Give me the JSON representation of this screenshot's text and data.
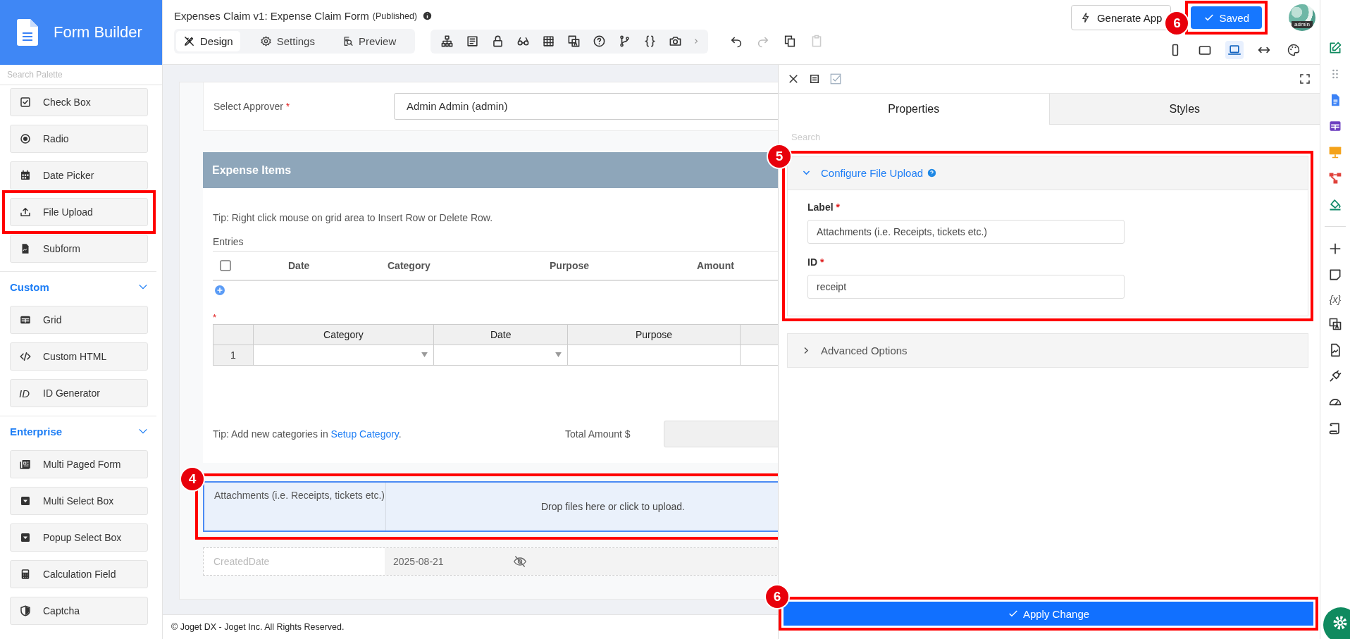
{
  "app": {
    "title": "Form Builder"
  },
  "palette": {
    "search_placeholder": "Search Palette",
    "groups": [
      {
        "items": [
          {
            "label": "Check Box",
            "kind": "checkbox",
            "marked": false
          },
          {
            "label": "Radio",
            "kind": "radio",
            "marked": false
          },
          {
            "label": "Date Picker",
            "kind": "calendar",
            "marked": false
          },
          {
            "label": "File Upload",
            "kind": "upload",
            "marked": true
          },
          {
            "label": "Subform",
            "kind": "document",
            "marked": false
          }
        ]
      },
      {
        "title": "Custom",
        "expanded": true,
        "items": [
          {
            "label": "Grid",
            "kind": "grid",
            "marked": false
          },
          {
            "label": "Custom HTML",
            "kind": "code",
            "marked": false
          },
          {
            "label": "ID Generator",
            "kind": "glyph",
            "glyph": "ID",
            "marked": false
          }
        ]
      },
      {
        "title": "Enterprise",
        "expanded": true,
        "items": [
          {
            "label": "Multi Paged Form",
            "kind": "pages",
            "marked": false
          },
          {
            "label": "Multi Select Box",
            "kind": "dropdown",
            "marked": false
          },
          {
            "label": "Popup Select Box",
            "kind": "dropdown",
            "marked": false
          },
          {
            "label": "Calculation Field",
            "kind": "calculator",
            "marked": false
          },
          {
            "label": "Captcha",
            "kind": "shield",
            "marked": false
          }
        ]
      }
    ]
  },
  "header": {
    "title": "Expenses Claim v1: Expense Claim Form",
    "status": "(Published)",
    "tabs": [
      {
        "label": "Design",
        "kind": "design",
        "selected": true
      },
      {
        "label": "Settings",
        "kind": "gear",
        "selected": false
      },
      {
        "label": "Preview",
        "kind": "preview",
        "selected": false
      }
    ],
    "generate_button": "Generate App",
    "save_button": {
      "label": "Saved",
      "marked": true,
      "callout": "6"
    },
    "avatar_caption": "admin",
    "device_modes": [
      {
        "kind": "phone",
        "selected": false
      },
      {
        "kind": "tablet",
        "selected": false
      },
      {
        "kind": "laptop",
        "selected": true
      },
      {
        "kind": "wide",
        "selected": false
      }
    ]
  },
  "form": {
    "approver": {
      "label": "Select Approver",
      "required_mark": "*",
      "value": "Admin Admin (admin)"
    },
    "section": {
      "title": "Expense Items",
      "tip": "Tip: Right click mouse on grid area to Insert Row or Delete Row.",
      "entries": {
        "label": "Entries",
        "checked": false,
        "columns": [
          "Date",
          "Category",
          "Purpose",
          "Amount"
        ]
      },
      "grid": {
        "required_mark": "*",
        "columns": [
          "Category",
          "Date",
          "Purpose"
        ],
        "rows": [
          {
            "number": "1"
          }
        ]
      },
      "tip2": {
        "text": "Tip: Add new categories in ",
        "link": "Setup Category",
        "after": "."
      },
      "total_label": "Total Amount $"
    },
    "attachments": {
      "label": "Attachments (i.e. Receipts, tickets etc.)",
      "dropzone": "Drop files here or click to upload.",
      "selected": true,
      "marked": true,
      "callout": "4"
    },
    "created": {
      "label": "CreatedDate",
      "value": "2025-08-21",
      "hidden": true
    }
  },
  "footer": "© Joget DX - Joget Inc. All Rights Reserved.",
  "properties": {
    "tabs": [
      {
        "label": "Properties",
        "selected": true
      },
      {
        "label": "Styles",
        "selected": false
      }
    ],
    "search_placeholder": "Search",
    "sections": [
      {
        "title": "Configure File Upload",
        "expanded": true,
        "help": true,
        "marked": true,
        "callout": "5",
        "fields": [
          {
            "label": "Label",
            "required_mark": "*",
            "value": "Attachments (i.e. Receipts, tickets etc.)"
          },
          {
            "label": "ID",
            "required_mark": "*",
            "value": "receipt"
          }
        ]
      },
      {
        "title": "Advanced Options",
        "expanded": false,
        "help": false,
        "marked": false
      }
    ],
    "apply_button": {
      "label": "Apply Change",
      "marked": true,
      "callout": "6"
    }
  },
  "rail": {
    "variables_glyph": "{x}"
  }
}
